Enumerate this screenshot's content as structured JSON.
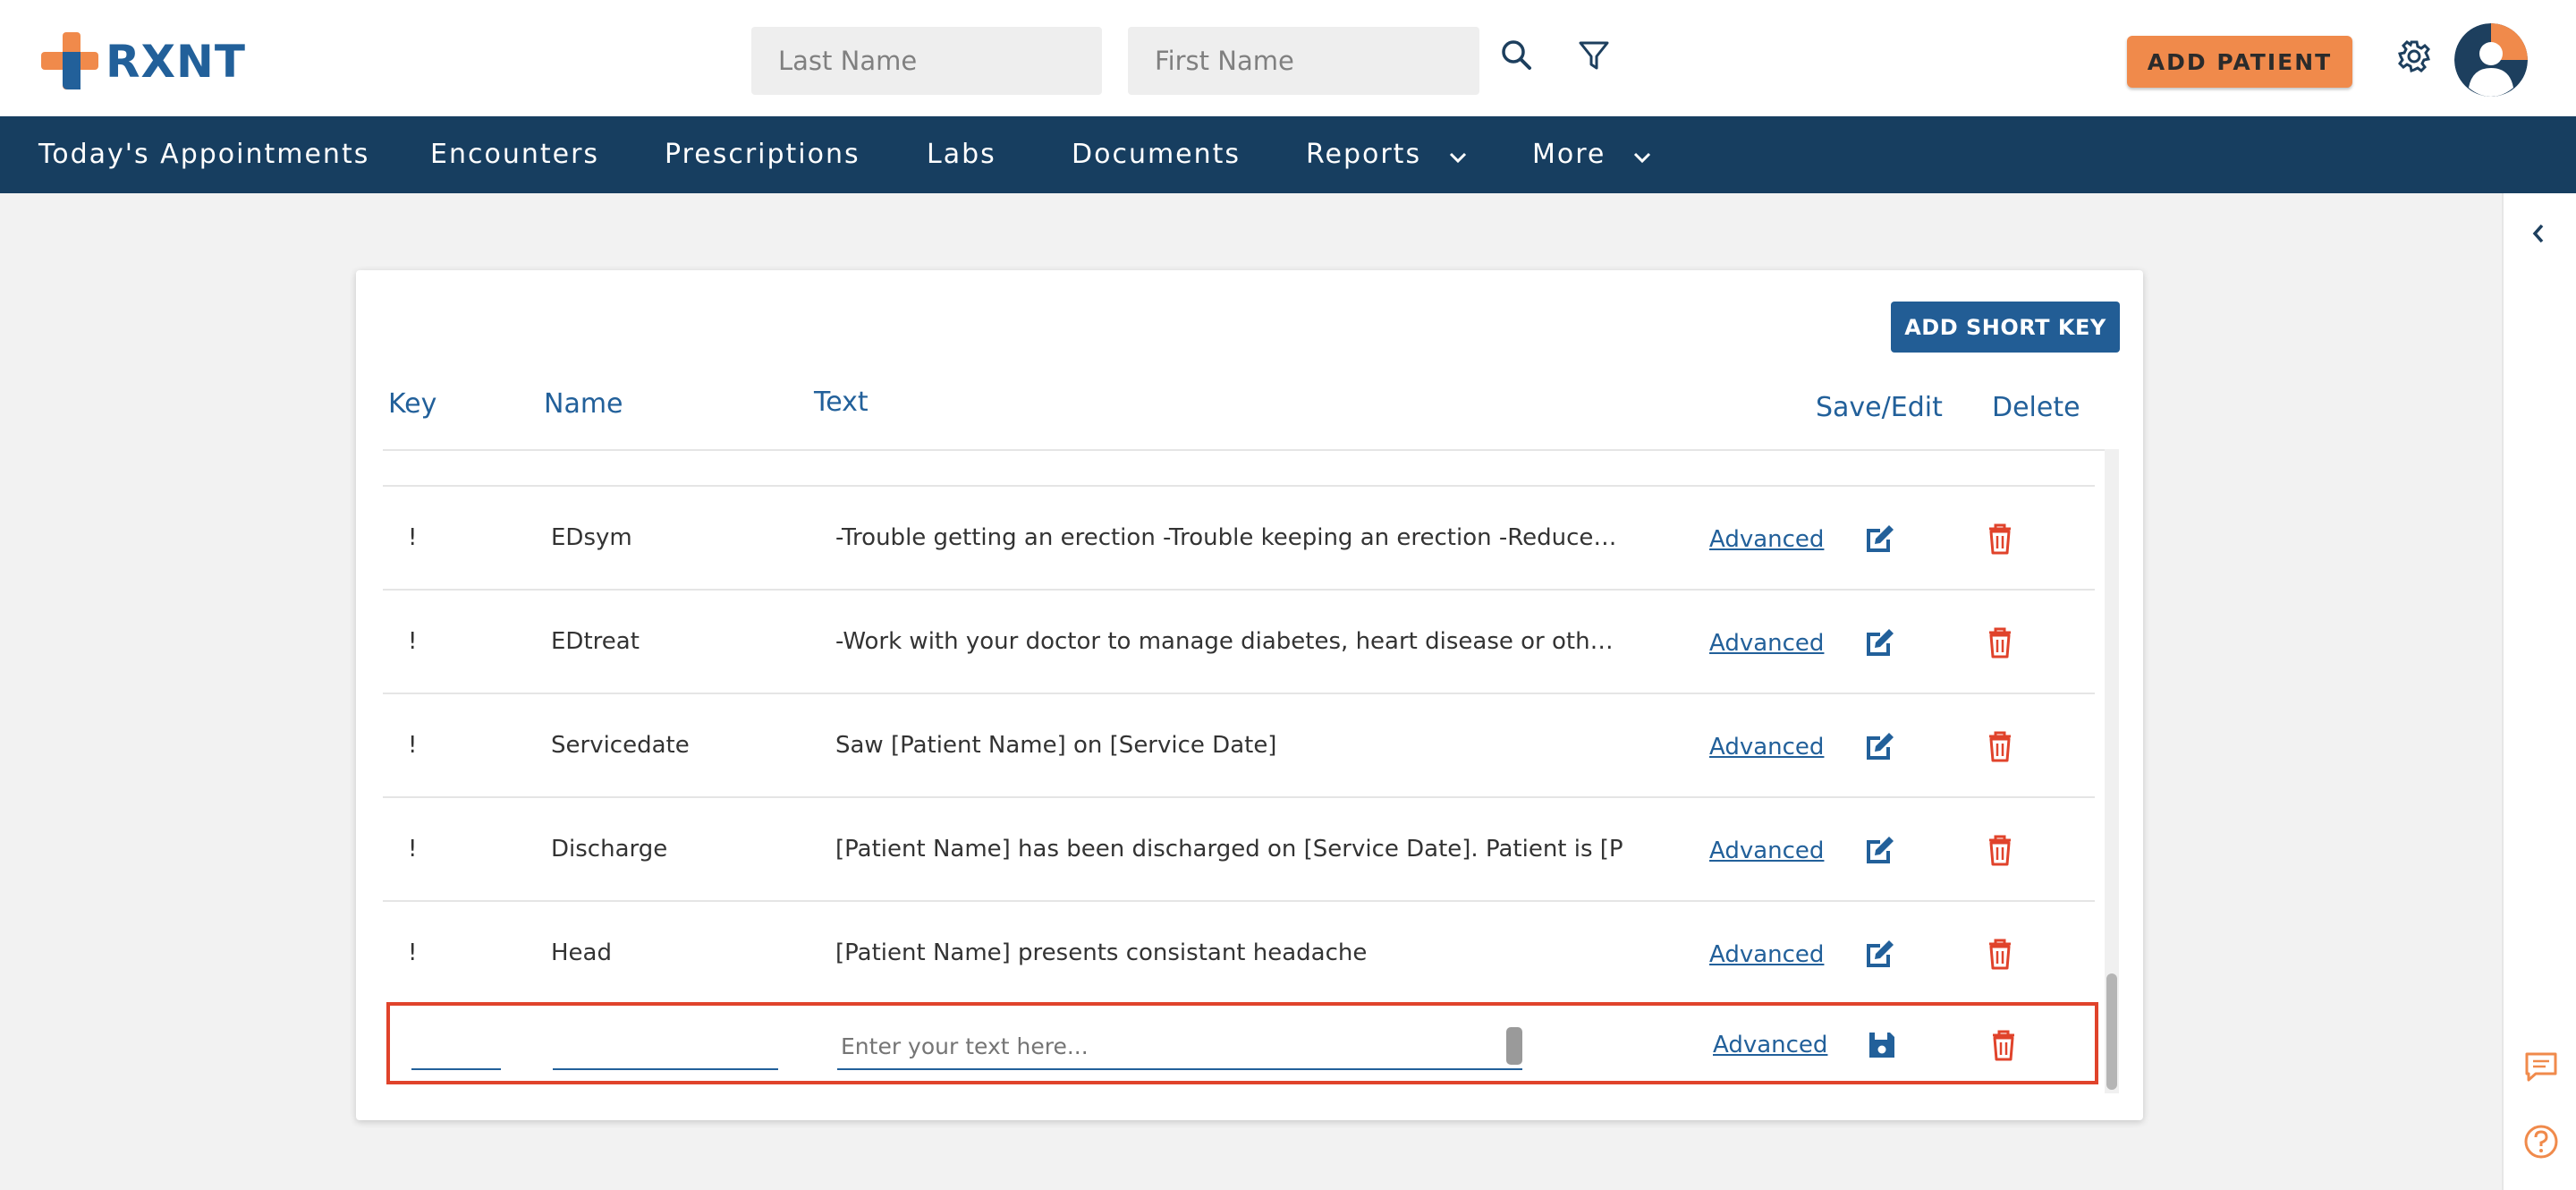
{
  "header": {
    "logo_text": "RXNT",
    "last_name_placeholder": "Last Name",
    "first_name_placeholder": "First Name",
    "add_patient_label": "ADD PATIENT"
  },
  "nav": {
    "items": [
      {
        "label": "Today's Appointments"
      },
      {
        "label": "Encounters"
      },
      {
        "label": "Prescriptions"
      },
      {
        "label": "Labs"
      },
      {
        "label": "Documents"
      },
      {
        "label": "Reports"
      },
      {
        "label": "More"
      }
    ]
  },
  "shortkeys": {
    "add_button_label": "ADD SHORT KEY",
    "columns": {
      "key": "Key",
      "name": "Name",
      "text": "Text",
      "save_edit": "Save/Edit",
      "delete": "Delete"
    },
    "rows": [
      {
        "key": "!",
        "name": "EDsym",
        "text": "-Trouble getting an erection -Trouble keeping an erection -Reduced sexua...",
        "advanced": "Advanced"
      },
      {
        "key": "!",
        "name": "EDtreat",
        "text": "-Work with your doctor to manage diabetes, heart disease or other chroni...",
        "advanced": "Advanced"
      },
      {
        "key": "!",
        "name": "Servicedate",
        "text": "Saw [Patient Name] on [Service Date]",
        "advanced": "Advanced"
      },
      {
        "key": "!",
        "name": "Discharge",
        "text": "[Patient Name] has been discharged on [Service Date]. Patient is [Patient A",
        "advanced": "Advanced"
      },
      {
        "key": "!",
        "name": "Head",
        "text": "[Patient Name] presents consistant headache",
        "advanced": "Advanced"
      }
    ],
    "new_row": {
      "key_value": "",
      "name_value": "",
      "text_value": "",
      "text_placeholder": "Enter your text here...",
      "advanced": "Advanced"
    }
  },
  "colors": {
    "nav_bg": "#173e60",
    "accent_blue": "#22609a",
    "button_orange": "#f08a4b",
    "delete_red": "#e0432b",
    "highlight_border": "#e0432b"
  },
  "icons": [
    "search-icon",
    "filter-icon",
    "gear-icon",
    "chevron-down-icon",
    "chevron-left-icon",
    "edit-icon",
    "trash-icon",
    "save-icon",
    "chat-icon",
    "help-icon"
  ]
}
